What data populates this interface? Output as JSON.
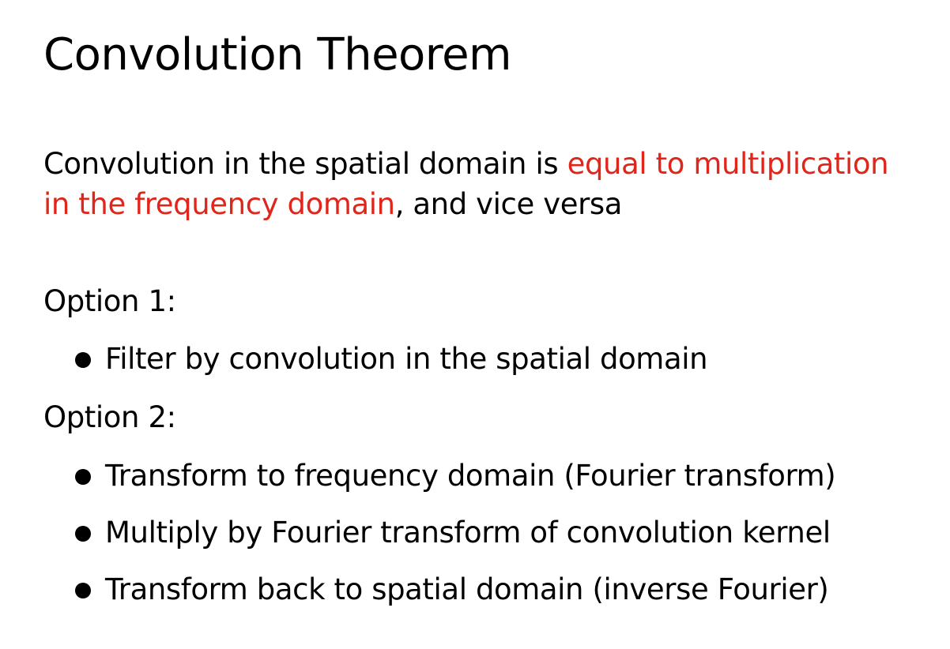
{
  "slide": {
    "title": "Convolution Theorem",
    "statement": {
      "line1_plain": "Convolution in the spatial domain is ",
      "line1_highlight": "equal to multiplication",
      "line2_highlight": "in the frequency domain",
      "line2_plain": ", and vice versa"
    },
    "options": [
      {
        "label": "Option 1:",
        "bullets": [
          "Filter by convolution in the spatial domain"
        ]
      },
      {
        "label": "Option 2:",
        "bullets": [
          "Transform to frequency domain (Fourier transform)",
          "Multiply by Fourier transform of convolution kernel",
          "Transform back to spatial domain (inverse Fourier)"
        ]
      }
    ]
  },
  "colors": {
    "highlight": "#e0261b",
    "text": "#000000",
    "background": "#ffffff"
  }
}
